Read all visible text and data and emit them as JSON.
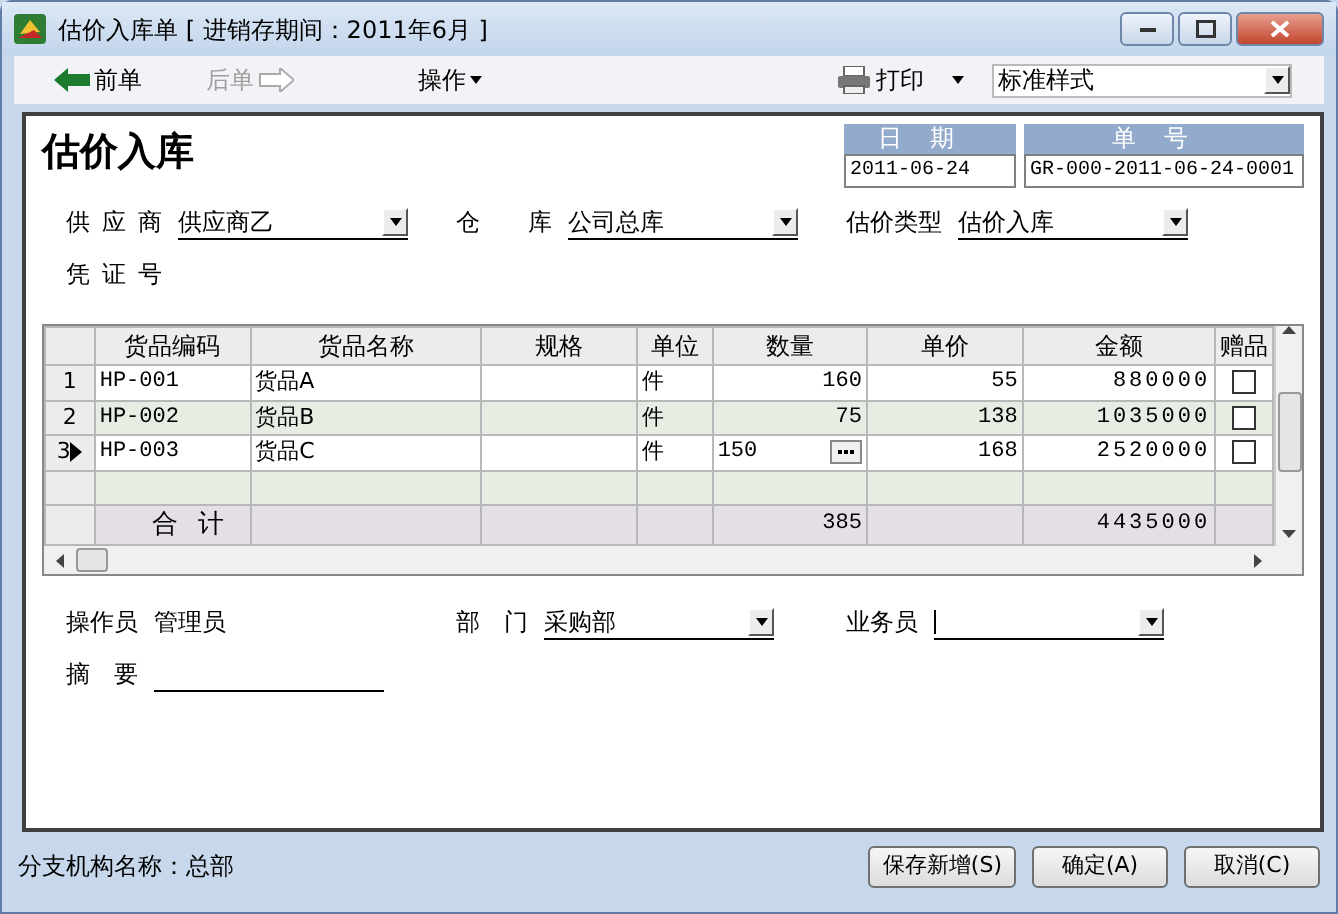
{
  "window": {
    "title": "估价入库单 [ 进销存期间：2011年6月 ]"
  },
  "toolbar": {
    "prev": {
      "label": "前单",
      "disabled": false
    },
    "next": {
      "label": "后单",
      "disabled": true
    },
    "operations": {
      "label": "操作"
    },
    "print": {
      "label": "打印"
    },
    "style_select": {
      "value": "标准样式"
    }
  },
  "form": {
    "title": "估价入库",
    "date": {
      "label": "日期",
      "value": "2011-06-24"
    },
    "number": {
      "label": "单号",
      "value": "GR-000-2011-06-24-0001"
    },
    "header_fields": [
      {
        "label": "供应商",
        "kind": "select",
        "value": "供应商乙"
      },
      {
        "label": "仓库",
        "kind": "select",
        "value": "公司总库"
      },
      {
        "label": "估价类型",
        "kind": "select",
        "value": "估价入库"
      },
      {
        "label": "凭证号",
        "kind": "none"
      }
    ],
    "table": {
      "columns": [
        "货品编码",
        "货品名称",
        "规格",
        "单位",
        "数量",
        "单价",
        "金额",
        "赠品"
      ],
      "rows": [
        {
          "index": "1",
          "code": "HP-001",
          "name": "货品A",
          "unit": "件",
          "quantity": "160",
          "price": "55",
          "amount": "880000",
          "gift": false,
          "selected": false,
          "editing": false
        },
        {
          "index": "2",
          "code": "HP-002",
          "name": "货品B",
          "unit": "件",
          "quantity": "75",
          "price": "138",
          "amount": "1035000",
          "gift": false,
          "selected": false,
          "editing": false
        },
        {
          "index": "3",
          "code": "HP-003",
          "name": "货品C",
          "unit": "件",
          "quantity": "150",
          "price": "168",
          "amount": "2520000",
          "gift": false,
          "selected": true,
          "editing": true
        }
      ],
      "totals": {
        "label": "合计",
        "quantity": "385",
        "amount": "4435000"
      }
    },
    "footer_fields": [
      {
        "label": "操作员",
        "kind": "text",
        "value": "管理员"
      },
      {
        "label": "部门",
        "kind": "select",
        "value": "采购部"
      },
      {
        "label": "业务员",
        "kind": "select",
        "focused": true
      },
      {
        "label": "摘要",
        "kind": "line"
      }
    ]
  },
  "status_bar": {
    "text": "分支机构名称：总部"
  },
  "buttons": [
    "保存新增(S)",
    "确定(A)",
    "取消(C)"
  ]
}
